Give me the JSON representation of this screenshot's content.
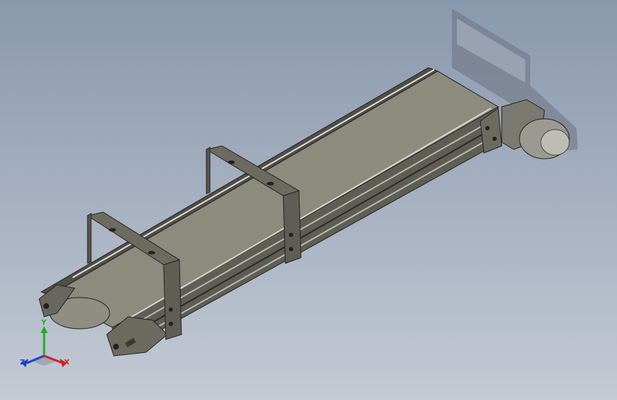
{
  "view": {
    "title": "",
    "background_top": "#8a98ad",
    "background_bottom": "#c4cad4"
  },
  "model": {
    "part": "belt-conveyor-assembly",
    "frame_color": "#6b6b60",
    "belt_color": "#8b8b7e",
    "motor_color": "#9a9a90",
    "support_count": 2
  },
  "triad": {
    "x_label": "X",
    "y_label": "Y",
    "z_label": "Z",
    "x_color": "#d02020",
    "y_color": "#20b020",
    "z_color": "#2040d0"
  }
}
